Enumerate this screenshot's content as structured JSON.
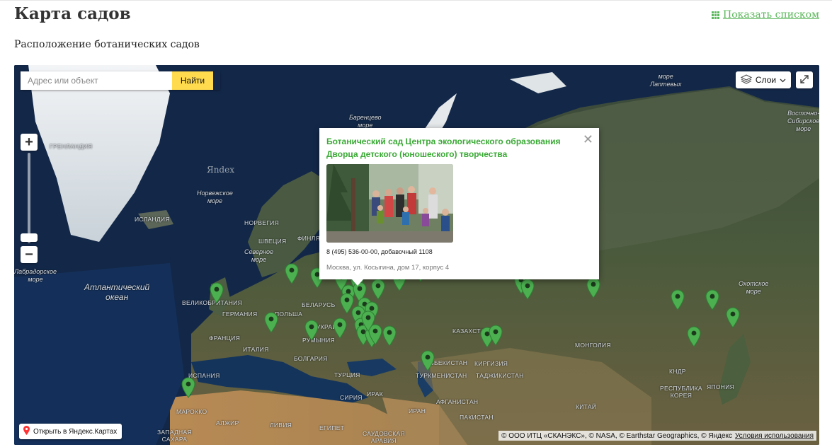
{
  "header": {
    "title": "Карта садов",
    "list_link": "Показать списком",
    "subtitle": "Расположение ботанических садов"
  },
  "map": {
    "search_placeholder": "Адрес или объект",
    "search_button": "Найти",
    "layers_label": "Слои",
    "open_in_yandex": "Открыть в Яндекс.Картах",
    "attribution": "© ООО ИТЦ «СКАНЭКС», © NASA, © Earthstar Geographics, © Яндекс",
    "terms_link": "Условия использования",
    "watermark": "Яndex",
    "labels": {
      "greenland": "ГРЕНЛАНДИЯ",
      "iceland": "ИСЛАНДИЯ",
      "norway": "НОРВЕГИЯ",
      "sweden": "ШВЕЦИЯ",
      "finland": "ФИНЛЯНДИЯ",
      "uk": "ВЕЛИКОБРИТАНИЯ",
      "germany": "ГЕРМАНИЯ",
      "poland": "ПОЛЬША",
      "belarus": "БЕЛАРУСЬ",
      "france": "ФРАНЦИЯ",
      "ukraine": "УКРАИНА",
      "italy": "ИТАЛИЯ",
      "romania": "РУМЫНИЯ",
      "spain": "ИСПАНИЯ",
      "bulgaria": "БОЛГАРИЯ",
      "turkey": "ТУРЦИЯ",
      "syria": "СИРИЯ",
      "iraq": "ИРАК",
      "iran": "ИРАН",
      "kazakhstan": "КАЗАХСТАН",
      "mongolia": "МОНГОЛИЯ",
      "china": "КИТАЙ",
      "japan": "ЯПОНИЯ",
      "korea": "РЕСПУБЛИКА\nКОРЕЯ",
      "kndr": "КНДР",
      "morocco": "МАРОККО",
      "algeria": "АЛЖИР",
      "libya": "ЛИВИЯ",
      "egypt": "ЕГИПЕТ",
      "saudi": "САУДОВСКАЯ\nАРАВИЯ",
      "afghanistan": "АФГАНИСТАН",
      "pakistan": "ПАКИСТАН",
      "turkmenistan": "ТУРКМЕНИСТАН",
      "uzbekistan": "УЗБЕКИСТАН",
      "kyrgyzstan": "КИРГИЗИЯ",
      "tajikistan": "ТАДЖИКИСТАН",
      "sahara": "ЗАПАДНАЯ\nСАХАРА",
      "atlantic": "Атлантический\nокеан",
      "norwegian_sea": "Норвежское\nморе",
      "barents": "Баренцево\nморе",
      "laptev": "море\nЛаптевых",
      "east_siberian": "Восточно-\nСибирское\nморе",
      "okhotsk": "Охотское\nморе",
      "labrador": "Лабрадорское\nморе",
      "north_sea": "Северное\nморе"
    }
  },
  "popup": {
    "title": "Ботанический сад Центра экологического образования Дворца детского (юношеского) творчества",
    "phone": "8 (495) 536-00-00, добавочный 1108",
    "address": "Москва, ул. Косыгина, дом 17, корпус 4"
  },
  "colors": {
    "accent_green": "#5cb85c",
    "pin_green": "#4caf50",
    "popup_title": "#3aaa35",
    "search_button": "#ffdb4d"
  }
}
